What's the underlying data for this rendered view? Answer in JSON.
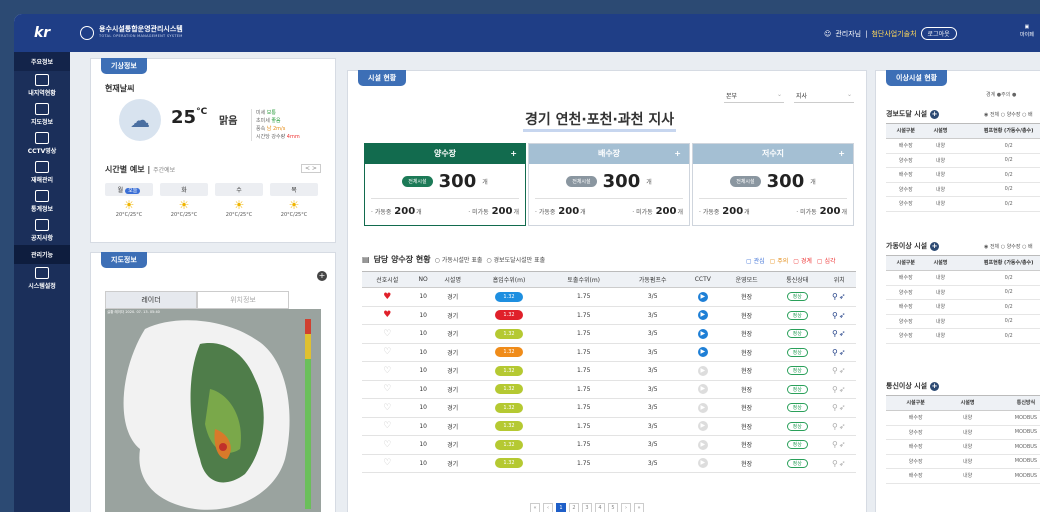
{
  "header": {
    "logo": "kr",
    "title": "용수시설통합운영관리시스템",
    "subtitle": "TOTAL OPERATION MANAGEMENT SYSTEM",
    "user": "관리자님",
    "org": "첨단사업기술처",
    "logout": "로그아웃",
    "mypage": "마이페"
  },
  "nav": [
    {
      "label": "주요정보",
      "kind": "head"
    },
    {
      "label": "내지역현황",
      "icon": "region-icon"
    },
    {
      "label": "지도정보",
      "icon": "map-icon"
    },
    {
      "label": "CCTV영상",
      "icon": "cctv-icon"
    },
    {
      "label": "재해관리",
      "icon": "disaster-icon"
    },
    {
      "label": "통계정보",
      "icon": "stats-icon"
    },
    {
      "label": "공지사항",
      "icon": "notice-icon"
    },
    {
      "label": "관리기능",
      "kind": "head"
    },
    {
      "label": "시스템설정",
      "icon": "settings-icon"
    }
  ],
  "weather": {
    "title": "기상정보",
    "current_label": "현재날씨",
    "temp": "25",
    "temp_unit": "°C",
    "condition": "맑음",
    "details": [
      {
        "label": "미세",
        "value": "보통"
      },
      {
        "label": "초미세",
        "value": "좋음"
      },
      {
        "label": "풍속",
        "value": "남 2m/s"
      },
      {
        "label": "시간당 강수량",
        "value": "4mm"
      }
    ],
    "forecast_title": "시간별 예보",
    "forecast_sub": "주간예보",
    "forecast_nav": "< >",
    "forecast": [
      {
        "day": "월",
        "tag": "오늘",
        "range": "20°C/25°C"
      },
      {
        "day": "화",
        "range": "20°C/25°C"
      },
      {
        "day": "수",
        "range": "20°C/25°C"
      },
      {
        "day": "목",
        "range": "20°C/25°C"
      }
    ]
  },
  "map": {
    "title": "지도정보",
    "tabs": [
      "레이더",
      "위치정보"
    ],
    "caption": "실황 레이더 2020. 07. 13. 05:40"
  },
  "facility": {
    "title": "시설 현황",
    "selects": [
      "본부",
      "지사"
    ],
    "region_title": "경기 연천·포천·과천 지사",
    "cards": [
      {
        "name": "양수장",
        "label": "전체시설",
        "count": "300",
        "unit": "개",
        "op_label": "가동중",
        "op": "200",
        "op_unit": "개",
        "off_label": "미가동",
        "off": "200",
        "off_unit": "개"
      },
      {
        "name": "배수장",
        "label": "전체시설",
        "count": "300",
        "unit": "개",
        "op_label": "가동중",
        "op": "200",
        "op_unit": "개",
        "off_label": "미가동",
        "off": "200",
        "off_unit": "개"
      },
      {
        "name": "저수지",
        "label": "전체시설",
        "count": "300",
        "unit": "개",
        "op_label": "가동중",
        "op": "200",
        "op_unit": "개",
        "off_label": "미가동",
        "off": "200",
        "off_unit": "개"
      }
    ],
    "table_title": "담당 양수장 현황",
    "radio1": "가동시설만 표출",
    "radio2": "경보도달시설만 표출",
    "legend": [
      "관심",
      "주의",
      "경계",
      "심각"
    ],
    "columns": [
      "선호시설",
      "NO",
      "시설명",
      "흡입수위(m)",
      "토출수위(m)",
      "가동펌프수",
      "CCTV",
      "운영모드",
      "통신상태",
      "위치"
    ],
    "rows": [
      {
        "fav": true,
        "no": "10",
        "name": "경기",
        "in": "1.32",
        "in_color": "blue",
        "out": "1.75",
        "pump": "3/5",
        "cctv": true,
        "mode": "현장",
        "comm": "정상"
      },
      {
        "fav": true,
        "no": "10",
        "name": "경기",
        "in": "1.32",
        "in_color": "red",
        "out": "1.75",
        "pump": "3/5",
        "cctv": true,
        "mode": "현장",
        "comm": "정상"
      },
      {
        "fav": false,
        "no": "10",
        "name": "경기",
        "in": "1.32",
        "in_color": "green",
        "out": "1.75",
        "pump": "3/5",
        "cctv": true,
        "mode": "현장",
        "comm": "정상"
      },
      {
        "fav": false,
        "no": "10",
        "name": "경기",
        "in": "1.32",
        "in_color": "orange",
        "out": "1.75",
        "pump": "3/5",
        "cctv": true,
        "mode": "현장",
        "comm": "정상"
      },
      {
        "fav": false,
        "no": "10",
        "name": "경기",
        "in": "1.32",
        "in_color": "green",
        "out": "1.75",
        "pump": "3/5",
        "cctv": false,
        "mode": "현장",
        "comm": "정상"
      },
      {
        "fav": false,
        "no": "10",
        "name": "경기",
        "in": "1.32",
        "in_color": "green",
        "out": "1.75",
        "pump": "3/5",
        "cctv": false,
        "mode": "현장",
        "comm": "정상"
      },
      {
        "fav": false,
        "no": "10",
        "name": "경기",
        "in": "1.32",
        "in_color": "green",
        "out": "1.75",
        "pump": "3/5",
        "cctv": false,
        "mode": "현장",
        "comm": "정상"
      },
      {
        "fav": false,
        "no": "10",
        "name": "경기",
        "in": "1.32",
        "in_color": "green",
        "out": "1.75",
        "pump": "3/5",
        "cctv": false,
        "mode": "현장",
        "comm": "정상"
      },
      {
        "fav": false,
        "no": "10",
        "name": "경기",
        "in": "1.32",
        "in_color": "green",
        "out": "1.75",
        "pump": "3/5",
        "cctv": false,
        "mode": "현장",
        "comm": "정상"
      },
      {
        "fav": false,
        "no": "10",
        "name": "경기",
        "in": "1.32",
        "in_color": "green",
        "out": "1.75",
        "pump": "3/5",
        "cctv": false,
        "mode": "현장",
        "comm": "정상"
      }
    ],
    "pages": [
      "«",
      "‹",
      "1",
      "2",
      "3",
      "4",
      "5",
      "›",
      "»"
    ],
    "current_page": "1"
  },
  "abnormal": {
    "title": "이상시설 현황",
    "legend": "경계 ●주의 ●",
    "sections": [
      {
        "title": "경보도달 시설",
        "radio": "◉ 전체 ○ 양수장 ○ 배",
        "cols": [
          "시설구분",
          "시설명",
          "펌프현황 (가동수/총수)"
        ],
        "rows": [
          [
            "배수장",
            "내양",
            "0/2"
          ],
          [
            "양수장",
            "내양",
            "0/2"
          ],
          [
            "배수장",
            "내양",
            "0/2"
          ],
          [
            "양수장",
            "내양",
            "0/2"
          ],
          [
            "양수장",
            "내양",
            "0/2"
          ]
        ]
      },
      {
        "title": "가동이상 시설",
        "radio": "◉ 전체 ○ 양수장 ○ 배",
        "cols": [
          "시설구분",
          "시설명",
          "펌프현황 (가동수/총수)"
        ],
        "rows": [
          [
            "배수장",
            "내양",
            "0/2"
          ],
          [
            "양수장",
            "내양",
            "0/2"
          ],
          [
            "배수장",
            "내양",
            "0/2"
          ],
          [
            "양수장",
            "내양",
            "0/2"
          ],
          [
            "양수장",
            "내양",
            "0/2"
          ]
        ]
      },
      {
        "title": "통신이상 시설",
        "radio": "",
        "cols": [
          "시설구분",
          "시설명",
          "통신방식"
        ],
        "rows": [
          [
            "배수장",
            "내양",
            "MODBUS"
          ],
          [
            "양수장",
            "내양",
            "MODBUS"
          ],
          [
            "배수장",
            "내양",
            "MODBUS"
          ],
          [
            "양수장",
            "내양",
            "MODBUS"
          ],
          [
            "배수장",
            "내양",
            "MODBUS"
          ]
        ]
      }
    ]
  }
}
